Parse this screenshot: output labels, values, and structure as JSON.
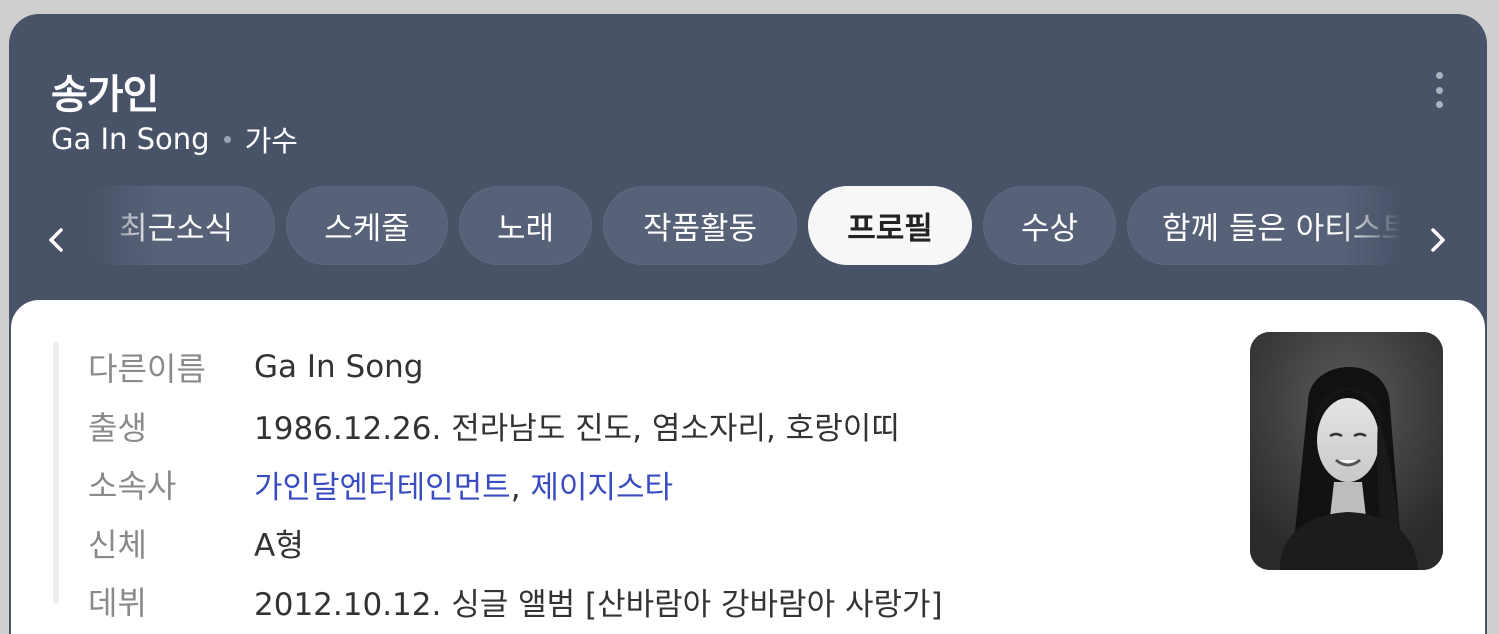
{
  "header": {
    "name": "송가인",
    "english_name": "Ga In Song",
    "occupation": "가수"
  },
  "tabs": [
    {
      "label": "최근소식"
    },
    {
      "label": "스케줄"
    },
    {
      "label": "노래"
    },
    {
      "label": "작품활동"
    },
    {
      "label": "프로필",
      "active": true
    },
    {
      "label": "수상"
    },
    {
      "label": "함께 들은 아티스트"
    }
  ],
  "profile": {
    "rows": [
      {
        "label": "다른이름",
        "value": "Ga In Song"
      },
      {
        "label": "출생",
        "value": "1986.12.26. 전라남도 진도, 염소자리, 호랑이띠"
      },
      {
        "label": "소속사",
        "links": [
          "가인달엔터테인먼트",
          "제이지스타"
        ],
        "separator": ", "
      },
      {
        "label": "신체",
        "value": "A형"
      },
      {
        "label": "데뷔",
        "value": "2012.10.12. 싱글 앨범 [산바람아 강바람아 사랑가]"
      }
    ]
  },
  "icons": {
    "more": "more-vertical-icon",
    "prev": "chevron-left-icon",
    "next": "chevron-right-icon"
  },
  "colors": {
    "header_bg": "#495368",
    "link": "#3b4cc0"
  }
}
